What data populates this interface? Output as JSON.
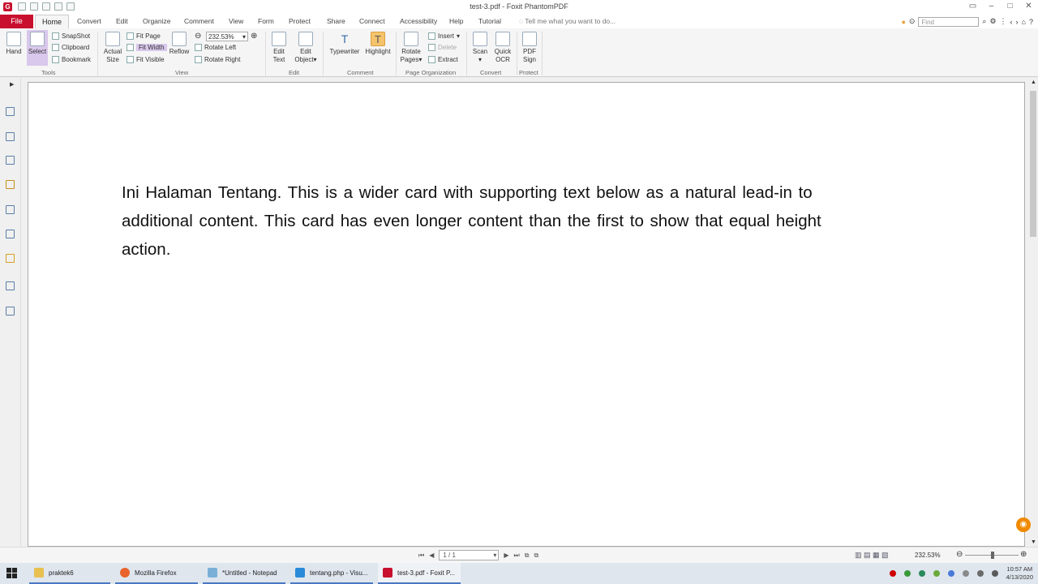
{
  "window": {
    "title": "test-3.pdf - Foxit PhantomPDF"
  },
  "menu": {
    "file": "File",
    "home": "Home",
    "items": [
      "Convert",
      "Edit",
      "Organize",
      "Comment",
      "View",
      "Form",
      "Protect",
      "Share",
      "Connect",
      "Accessibility",
      "Help",
      "Tutorial"
    ],
    "tell": "Tell me what you want to do...",
    "find_placeholder": "Find"
  },
  "ribbon": {
    "hand": "Hand",
    "select": "Select",
    "snapshot": "SnapShot",
    "clipboard": "Clipboard",
    "bookmark": "Bookmark",
    "tools_label": "Tools",
    "actual_size_1": "Actual",
    "actual_size_2": "Size",
    "fit_page": "Fit Page",
    "fit_width": "Fit Width",
    "fit_visible": "Fit Visible",
    "reflow": "Reflow",
    "zoom_value": "232.53%",
    "rotate_left": "Rotate Left",
    "rotate_right": "Rotate Right",
    "view_label": "View",
    "edit_text_1": "Edit",
    "edit_text_2": "Text",
    "edit_object_1": "Edit",
    "edit_object_2": "Object",
    "edit_label": "Edit",
    "typewriter": "Typewriter",
    "highlight": "Highlight",
    "comment_label": "Comment",
    "rotate_pages_1": "Rotate",
    "rotate_pages_2": "Pages",
    "insert": "Insert",
    "delete": "Delete",
    "extract": "Extract",
    "page_org_label": "Page Organization",
    "scan": "Scan",
    "quick_ocr_1": "Quick",
    "quick_ocr_2": "OCR",
    "convert_label": "Convert",
    "pdf_sign_1": "PDF",
    "pdf_sign_2": "Sign",
    "protect_label": "Protect"
  },
  "document": {
    "text": "Ini Halaman Tentang. This is a wider card with supporting text below as a natural lead-in to additional content. This card has even longer content than the first to show that equal height action."
  },
  "status": {
    "page": "1 / 1",
    "zoom": "232.53%"
  },
  "taskbar": {
    "items": [
      "praktek6",
      "Mozilla Firefox",
      "*Untitled - Notepad",
      "tentang.php - Visu...",
      "test-3.pdf - Foxit P..."
    ],
    "time": "10:57 AM",
    "date": "4/13/2020"
  }
}
